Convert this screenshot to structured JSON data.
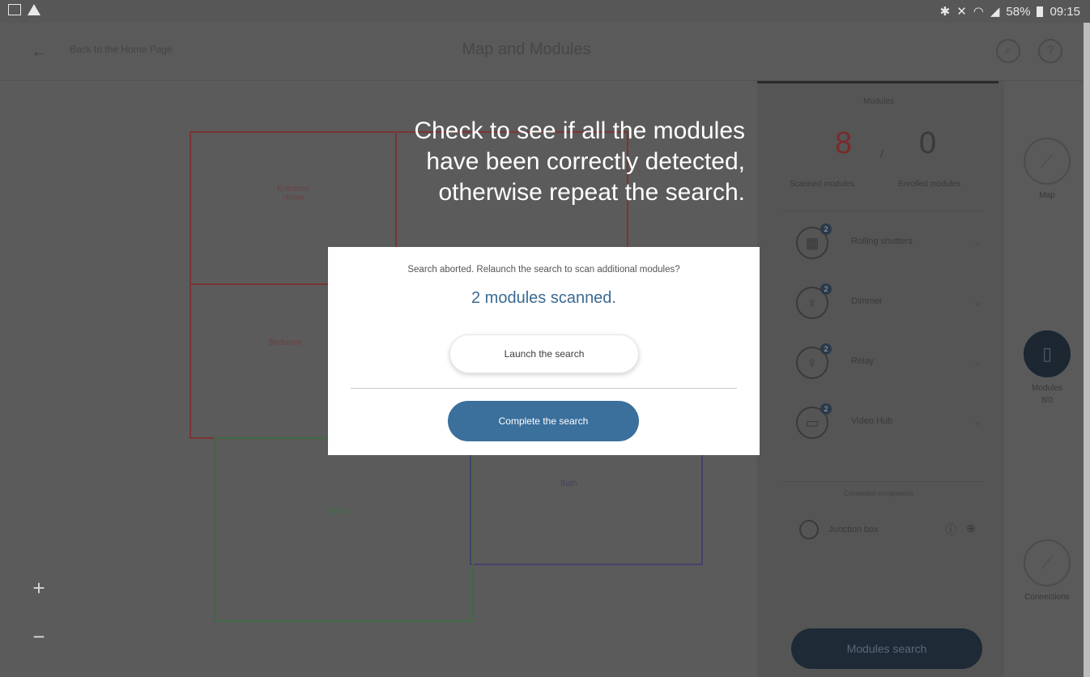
{
  "status_bar": {
    "battery": "58%",
    "time": "09:15",
    "icons": [
      "image-icon",
      "warning-icon",
      "bluetooth-icon",
      "mute-icon",
      "wifi-icon",
      "signal-icon",
      "battery-icon"
    ]
  },
  "header": {
    "back_label": "Back to the Home Page",
    "title": "Map and Modules",
    "icons": [
      "search-icon",
      "help-icon"
    ]
  },
  "panel": {
    "title": "Modules",
    "scanned_count": "8",
    "separator": "/",
    "enrolled_count": "0",
    "scanned_label": "Scanned modules",
    "enrolled_label": "Enrolled modules",
    "modules": [
      {
        "label": "Rolling shutters",
        "badge": "2"
      },
      {
        "label": "Dimmer",
        "badge": "2"
      },
      {
        "label": "Relay",
        "badge": "2"
      },
      {
        "label": "Video Hub",
        "badge": "2"
      }
    ],
    "junction_title": "Connection components",
    "junction_label": "Junction box",
    "modules_search": "Modules search"
  },
  "sidenav": {
    "items": [
      {
        "label": "Map",
        "icon": "map-icon"
      },
      {
        "label": "Modules",
        "sublabel": "8/0",
        "icon": "tablet-icon"
      },
      {
        "label": "Connections",
        "icon": "link-icon"
      }
    ]
  },
  "map": {
    "rooms": [
      {
        "label": "Entrance Home"
      },
      {
        "label": "Kitchen"
      },
      {
        "label": "Bedroom"
      },
      {
        "label": "Bath"
      }
    ],
    "zoom_in": "+",
    "zoom_out": "−"
  },
  "hint": {
    "line1": "Check to see if all the modules",
    "line2": "have been correctly detected,",
    "line3": "otherwise repeat the search."
  },
  "dialog": {
    "message": "Search aborted. Relaunch the search to scan additional modules?",
    "count_text": "2 modules scanned.",
    "launch_button": "Launch the search",
    "complete_button": "Complete the search"
  },
  "colors": {
    "primary_button": "#3b6f9c",
    "count_text": "#3c6a93",
    "overlay": "#5b5b5b",
    "scanned_count": "#7a2a2a"
  }
}
